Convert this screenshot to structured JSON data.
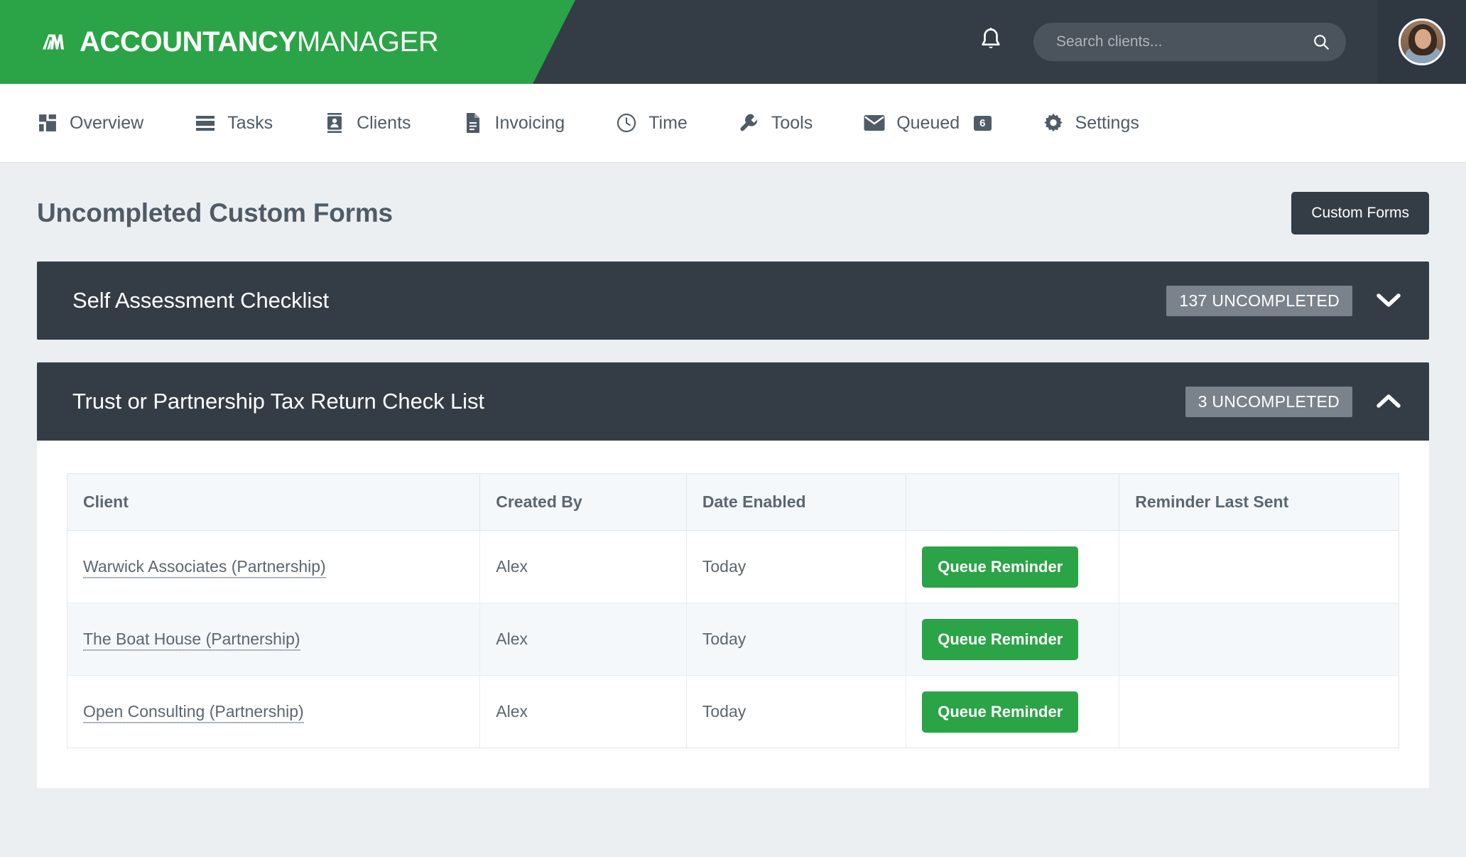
{
  "brand": {
    "name_bold": "ACCOUNTANCY",
    "name_light": "MANAGER",
    "logo_icon": "am-monogram-logo",
    "green": "#2aa446",
    "dark": "#343d46"
  },
  "header": {
    "notifications_icon": "bell-icon",
    "search": {
      "placeholder": "Search clients...",
      "value": "",
      "icon": "search-icon"
    },
    "avatar_icon": "user-avatar"
  },
  "nav": {
    "items": [
      {
        "label": "Overview",
        "icon": "dashboard-grid-icon",
        "badge": ""
      },
      {
        "label": "Tasks",
        "icon": "list-lines-icon",
        "badge": ""
      },
      {
        "label": "Clients",
        "icon": "contact-card-icon",
        "badge": ""
      },
      {
        "label": "Invoicing",
        "icon": "document-icon",
        "badge": ""
      },
      {
        "label": "Time",
        "icon": "clock-icon",
        "badge": ""
      },
      {
        "label": "Tools",
        "icon": "wrench-icon",
        "badge": ""
      },
      {
        "label": "Queued",
        "icon": "envelope-icon",
        "badge": "6"
      },
      {
        "label": "Settings",
        "icon": "gear-icon",
        "badge": ""
      }
    ]
  },
  "page": {
    "title": "Uncompleted Custom Forms",
    "custom_forms_button": "Custom Forms"
  },
  "accordions": [
    {
      "title": "Self Assessment Checklist",
      "count_label": "137 UNCOMPLETED",
      "expanded": false,
      "chevron_icon": "chevron-down-icon"
    },
    {
      "title": "Trust or Partnership Tax Return Check List",
      "count_label": "3 UNCOMPLETED",
      "expanded": true,
      "chevron_icon": "chevron-up-icon"
    }
  ],
  "table": {
    "columns": [
      "Client",
      "Created By",
      "Date Enabled",
      "",
      "Reminder Last Sent"
    ],
    "rows": [
      {
        "client": "Warwick Associates (Partnership)",
        "created_by": "Alex",
        "date_enabled": "Today",
        "action": "Queue Reminder",
        "reminder_last_sent": ""
      },
      {
        "client": "The Boat House (Partnership)",
        "created_by": "Alex",
        "date_enabled": "Today",
        "action": "Queue Reminder",
        "reminder_last_sent": ""
      },
      {
        "client": "Open Consulting (Partnership)",
        "created_by": "Alex",
        "date_enabled": "Today",
        "action": "Queue Reminder",
        "reminder_last_sent": ""
      }
    ]
  }
}
